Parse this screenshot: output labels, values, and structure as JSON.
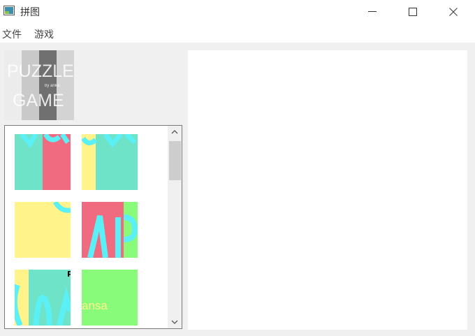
{
  "window": {
    "title": "拼图"
  },
  "menu": {
    "items": [
      "文件",
      "游戏"
    ]
  },
  "preview": {
    "line1": "PUZZLE",
    "line2": "GAME",
    "byline": "by anka"
  },
  "pieces": [
    {
      "id": "piece-1",
      "caption": ""
    },
    {
      "id": "piece-2",
      "caption": ""
    },
    {
      "id": "piece-3",
      "caption": ""
    },
    {
      "id": "piece-4",
      "caption": ""
    },
    {
      "id": "piece-5",
      "caption": "P"
    },
    {
      "id": "piece-6",
      "caption": "ansa"
    }
  ],
  "colors": {
    "teal": "#6fe3c8",
    "red": "#f06a80",
    "yellow": "#fff38a",
    "green": "#88fb7a",
    "cyan": "#5af0f5"
  }
}
